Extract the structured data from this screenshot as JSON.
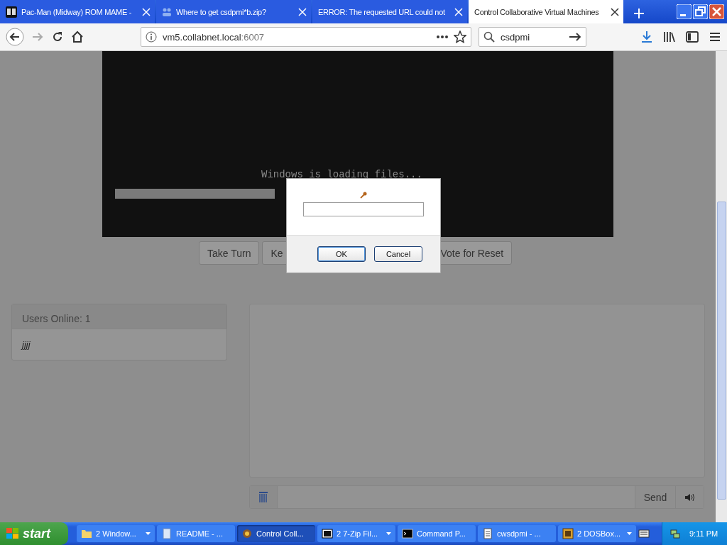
{
  "browser": {
    "tabs": [
      {
        "title": "Pac-Man (Midway) ROM MAME -",
        "selected": false
      },
      {
        "title": "Where to get csdpmi*b.zip?",
        "selected": false
      },
      {
        "title": "ERROR: The requested URL could not",
        "selected": false
      },
      {
        "title": "Control Collaborative Virtual Machines",
        "selected": true
      }
    ],
    "address": {
      "host": "vm5.collabnet.local",
      "port": ":6007"
    },
    "search": {
      "value": "csdpmi"
    }
  },
  "vm_screen": {
    "message": "Windows is loading files..."
  },
  "vm_buttons": [
    "Take Turn",
    "Ke",
    "Vote for Reset"
  ],
  "users": {
    "header": "Users Online: 1",
    "names": [
      "jjjj"
    ]
  },
  "chat": {
    "send": "Send"
  },
  "dialog": {
    "ok": "OK",
    "cancel": "Cancel"
  },
  "taskbar": {
    "start": "start",
    "items": [
      {
        "label": "2 Window...",
        "kind": "group",
        "selected": false
      },
      {
        "label": "README - ...",
        "kind": "single",
        "selected": false
      },
      {
        "label": "Control Coll...",
        "kind": "single",
        "selected": true
      },
      {
        "label": "2 7-Zip Fil...",
        "kind": "group",
        "selected": false
      },
      {
        "label": "Command P...",
        "kind": "single",
        "selected": false
      },
      {
        "label": "cwsdpmi - ...",
        "kind": "single",
        "selected": false
      },
      {
        "label": "2 DOSBox...",
        "kind": "group",
        "selected": false
      }
    ],
    "clock": "9:11 PM"
  }
}
